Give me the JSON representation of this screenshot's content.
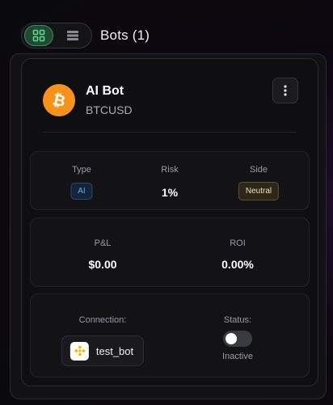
{
  "header": {
    "title": "Bots (1)",
    "view_toggle": {
      "active": "grid",
      "grid_icon": "grid-view-icon",
      "list_icon": "list-view-icon"
    }
  },
  "bot": {
    "name": "AI Bot",
    "symbol": "BTCUSD",
    "coin_icon": "bitcoin-icon",
    "menu_icon": "more-vertical-icon"
  },
  "stats": {
    "type_label": "Type",
    "type_value": "AI",
    "risk_label": "Risk",
    "risk_value": "1%",
    "side_label": "Side",
    "side_value": "Neutral"
  },
  "performance": {
    "pnl_label": "P&L",
    "pnl_value": "$0.00",
    "roi_label": "ROI",
    "roi_value": "0.00%"
  },
  "connection": {
    "label": "Connection:",
    "name": "test_bot",
    "exchange_icon": "binance-icon"
  },
  "status": {
    "label": "Status:",
    "value": "Inactive",
    "enabled": false
  },
  "colors": {
    "accent_green": "#3c8a5e",
    "bitcoin_orange": "#f7931a",
    "binance_yellow": "#f0b90b",
    "ai_badge_blue": "#6ea6f0",
    "neutral_badge": "#efe3b6"
  }
}
